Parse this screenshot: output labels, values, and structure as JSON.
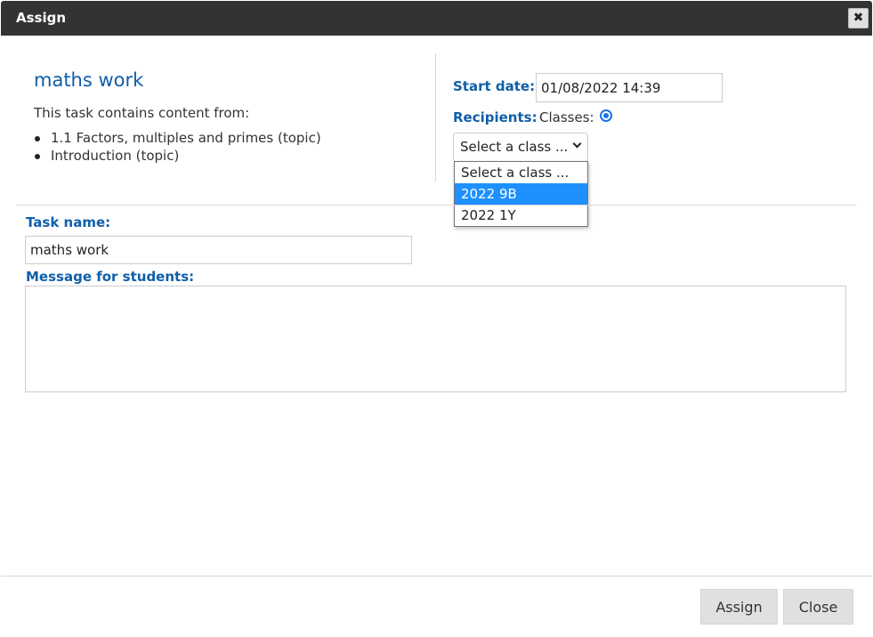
{
  "dialog": {
    "title": "Assign",
    "close_icon": "close-icon"
  },
  "task": {
    "heading": "maths work",
    "contains_text": "This task contains content from:",
    "topics": [
      "1.1 Factors, multiples and primes (topic)",
      "Introduction (topic)"
    ]
  },
  "assignment": {
    "start_date_label": "Start date:",
    "start_date_value": "01/08/2022 14:39",
    "recipients_label": "Recipients:",
    "classes_label": "Classes:",
    "class_select_value": "Select a class ...",
    "class_options": [
      "Select a class ...",
      "2022 9B",
      "2022 1Y"
    ],
    "highlighted_option": "2022 9B"
  },
  "form": {
    "task_name_label": "Task name:",
    "task_name_value": "maths work",
    "message_label": "Message for students:",
    "message_value": ""
  },
  "footer": {
    "assign_label": "Assign",
    "close_label": "Close"
  },
  "colors": {
    "title_bar": "#333333",
    "label_blue": "#0f5fa8",
    "option_highlight": "#1e90ff",
    "button_bg": "#e0e0e0"
  }
}
